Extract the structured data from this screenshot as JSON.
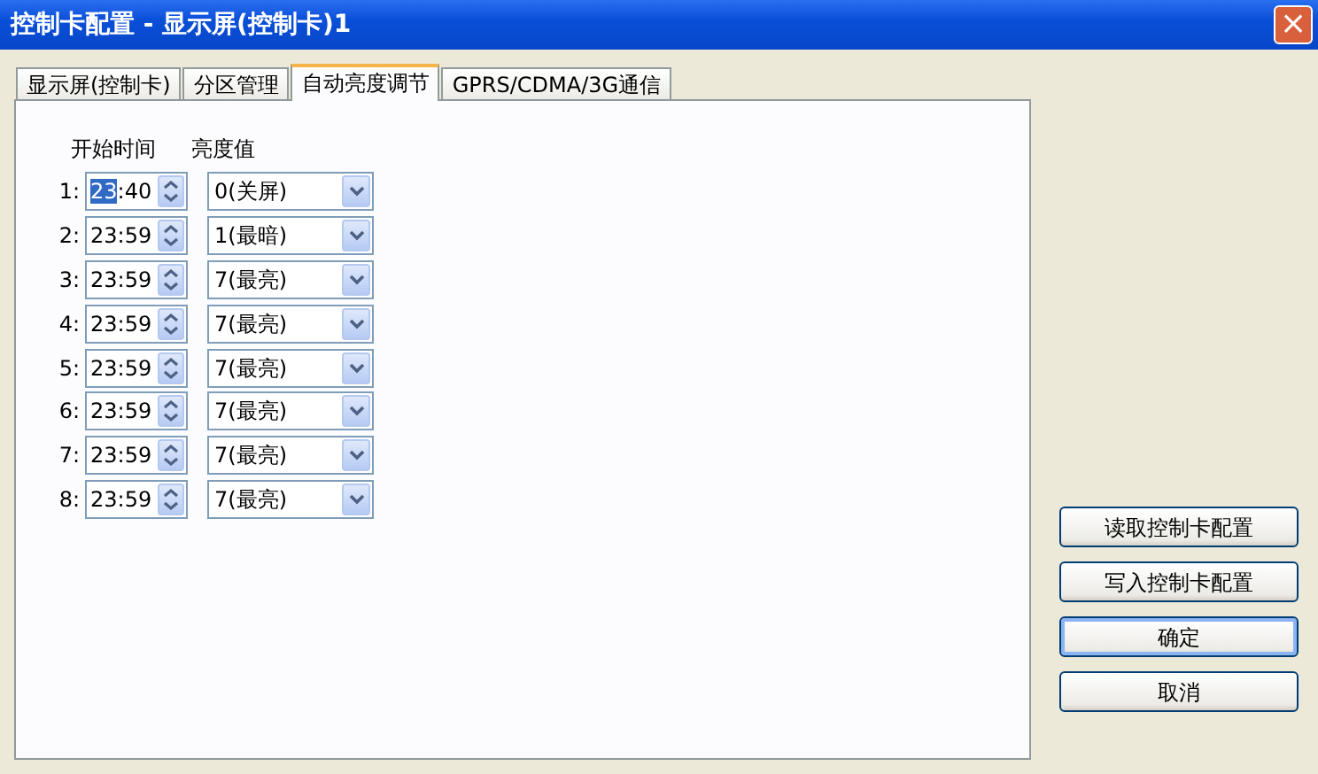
{
  "window": {
    "title": "控制卡配置 - 显示屏(控制卡)1",
    "close": "×"
  },
  "tabs": [
    {
      "label": "显示屏(控制卡)",
      "selected": false
    },
    {
      "label": "分区管理",
      "selected": false
    },
    {
      "label": "自动亮度调节",
      "selected": true
    },
    {
      "label": "GPRS/CDMA/3G通信",
      "selected": false
    }
  ],
  "columns": [
    "开始时间",
    "亮度值"
  ],
  "rows": [
    {
      "label": "1:",
      "hour": "23",
      "minute": ":40",
      "hour_selected": true,
      "brightness": "0(关屏)"
    },
    {
      "label": "2:",
      "hour": "23",
      "minute": ":59",
      "hour_selected": false,
      "brightness": "1(最暗)"
    },
    {
      "label": "3:",
      "hour": "23",
      "minute": ":59",
      "hour_selected": false,
      "brightness": "7(最亮)"
    },
    {
      "label": "4:",
      "hour": "23",
      "minute": ":59",
      "hour_selected": false,
      "brightness": "7(最亮)"
    },
    {
      "label": "5:",
      "hour": "23",
      "minute": ":59",
      "hour_selected": false,
      "brightness": "7(最亮)"
    },
    {
      "label": "6:",
      "hour": "23",
      "minute": ":59",
      "hour_selected": false,
      "brightness": "7(最亮)"
    },
    {
      "label": "7:",
      "hour": "23",
      "minute": ":59",
      "hour_selected": false,
      "brightness": "7(最亮)"
    },
    {
      "label": "8:",
      "hour": "23",
      "minute": ":59",
      "hour_selected": false,
      "brightness": "7(最亮)"
    }
  ],
  "buttons": [
    {
      "label": "读取控制卡配置",
      "default": false
    },
    {
      "label": "写入控制卡配置",
      "default": false
    },
    {
      "label": "确定",
      "default": true
    },
    {
      "label": "取消",
      "default": false
    }
  ]
}
